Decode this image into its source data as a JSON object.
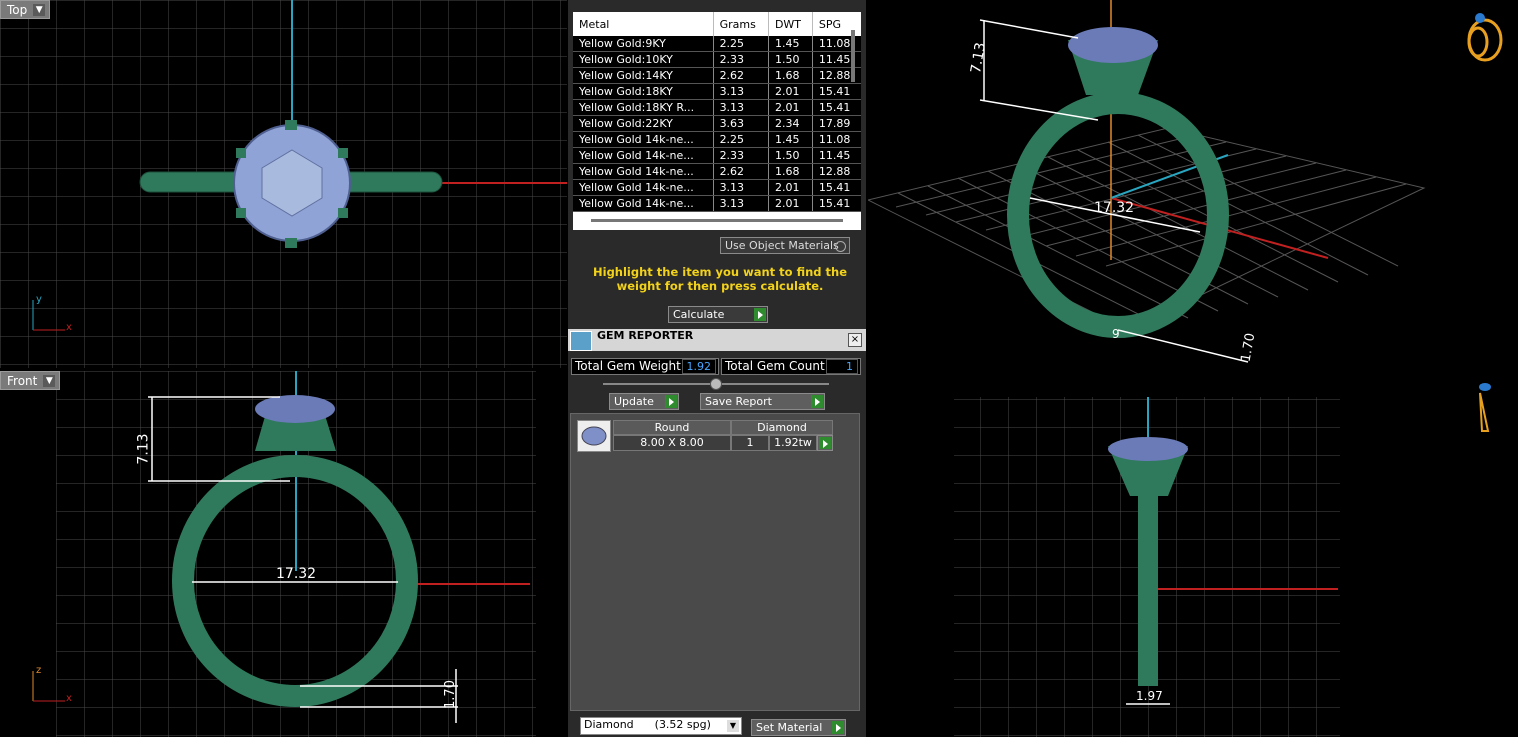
{
  "viewports": {
    "top": {
      "label": "Top",
      "axis_a": "y",
      "axis_b": "x"
    },
    "front": {
      "label": "Front",
      "axis_a": "z",
      "axis_b": "x"
    },
    "perspective": {
      "dim_height": "7.13",
      "dim_width": "17.32",
      "dim_band": "1.70",
      "dim_small": "9"
    },
    "right": {
      "dim_band": "1.97"
    },
    "front_dims": {
      "height": "7.13",
      "width": "17.32",
      "band": "1.70"
    }
  },
  "weight_table": {
    "headers": [
      "Metal",
      "Grams",
      "DWT",
      "SPG"
    ],
    "rows": [
      [
        "Yellow Gold:9KY",
        "2.25",
        "1.45",
        "11.08"
      ],
      [
        "Yellow Gold:10KY",
        "2.33",
        "1.50",
        "11.45"
      ],
      [
        "Yellow Gold:14KY",
        "2.62",
        "1.68",
        "12.88"
      ],
      [
        "Yellow Gold:18KY",
        "3.13",
        "2.01",
        "15.41"
      ],
      [
        "Yellow Gold:18KY R...",
        "3.13",
        "2.01",
        "15.41"
      ],
      [
        "Yellow Gold:22KY",
        "3.63",
        "2.34",
        "17.89"
      ],
      [
        "Yellow Gold 14k-ne...",
        "2.25",
        "1.45",
        "11.08"
      ],
      [
        "Yellow Gold 14k-ne...",
        "2.33",
        "1.50",
        "11.45"
      ],
      [
        "Yellow Gold 14k-ne...",
        "2.62",
        "1.68",
        "12.88"
      ],
      [
        "Yellow Gold 14k-ne...",
        "3.13",
        "2.01",
        "15.41"
      ],
      [
        "Yellow Gold 14k-ne...",
        "3.13",
        "2.01",
        "15.41"
      ]
    ]
  },
  "use_object_materials": "Use Object Materials",
  "hint": "Highlight the item you want to find the weight for then press calculate.",
  "calculate": "Calculate",
  "gem_reporter": {
    "title": "GEM REPORTER",
    "total_weight_label": "Total Gem Weight",
    "total_weight": "1.92",
    "total_count_label": "Total Gem Count",
    "total_count": "1",
    "update": "Update",
    "save_report": "Save Report",
    "shape": "Round",
    "type": "Diamond",
    "size": "8.00 X 8.00",
    "qty": "1",
    "tw": "1.92tw",
    "material_select": "Diamond      (3.52 spg)",
    "set_material": "Set Material"
  },
  "colors": {
    "ring": "#2f7a5c",
    "gem": "#7f8fc8",
    "grid": "#5a5a5a",
    "accent": "#f2d21a"
  }
}
